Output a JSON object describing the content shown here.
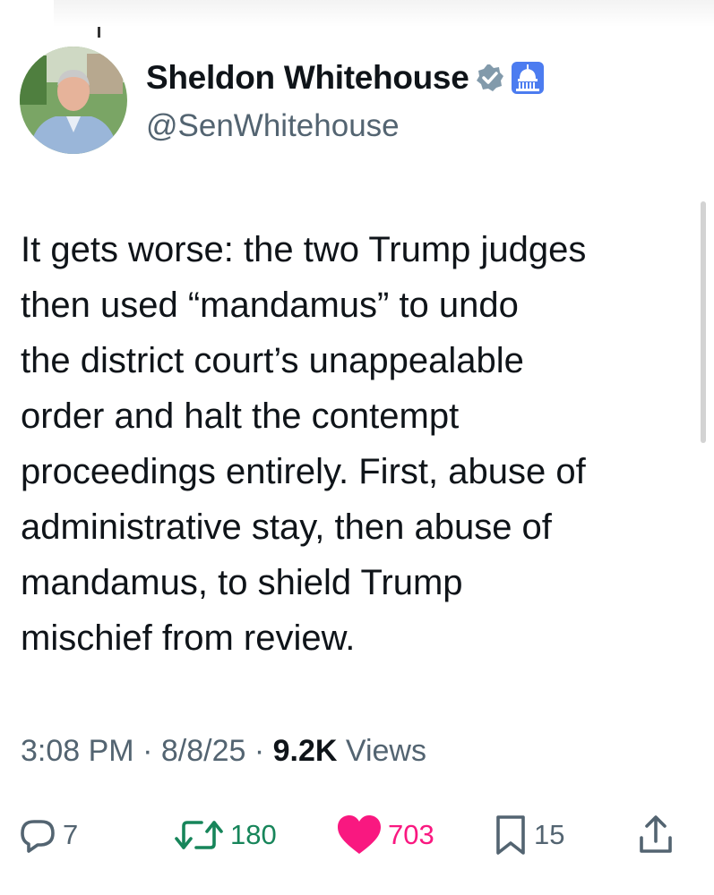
{
  "author": {
    "display_name": "Sheldon Whitehouse",
    "handle": "@SenWhitehouse",
    "verified": true,
    "affiliation_badge": "capitol-dome-icon"
  },
  "tweet": {
    "text": "It gets worse: the two Trump judges\nthen used “mandamus” to undo\nthe district court’s unappealable\norder and halt the contempt\nproceedings entirely. First, abuse of\nadministrative stay, then abuse of\nmandamus, to shield Trump\nmischief from review."
  },
  "meta": {
    "time": "3:08 PM",
    "separator": "·",
    "date": "8/8/25",
    "views_count": "9.2K",
    "views_label": "Views"
  },
  "actions": {
    "replies": "7",
    "retweets": "180",
    "likes": "703",
    "bookmarks": "15"
  },
  "colors": {
    "verified": "#829aab",
    "badge": "#4c7cf0",
    "retweet": "#17855a",
    "like": "#f91880",
    "muted": "#536471",
    "text": "#0f1419"
  }
}
